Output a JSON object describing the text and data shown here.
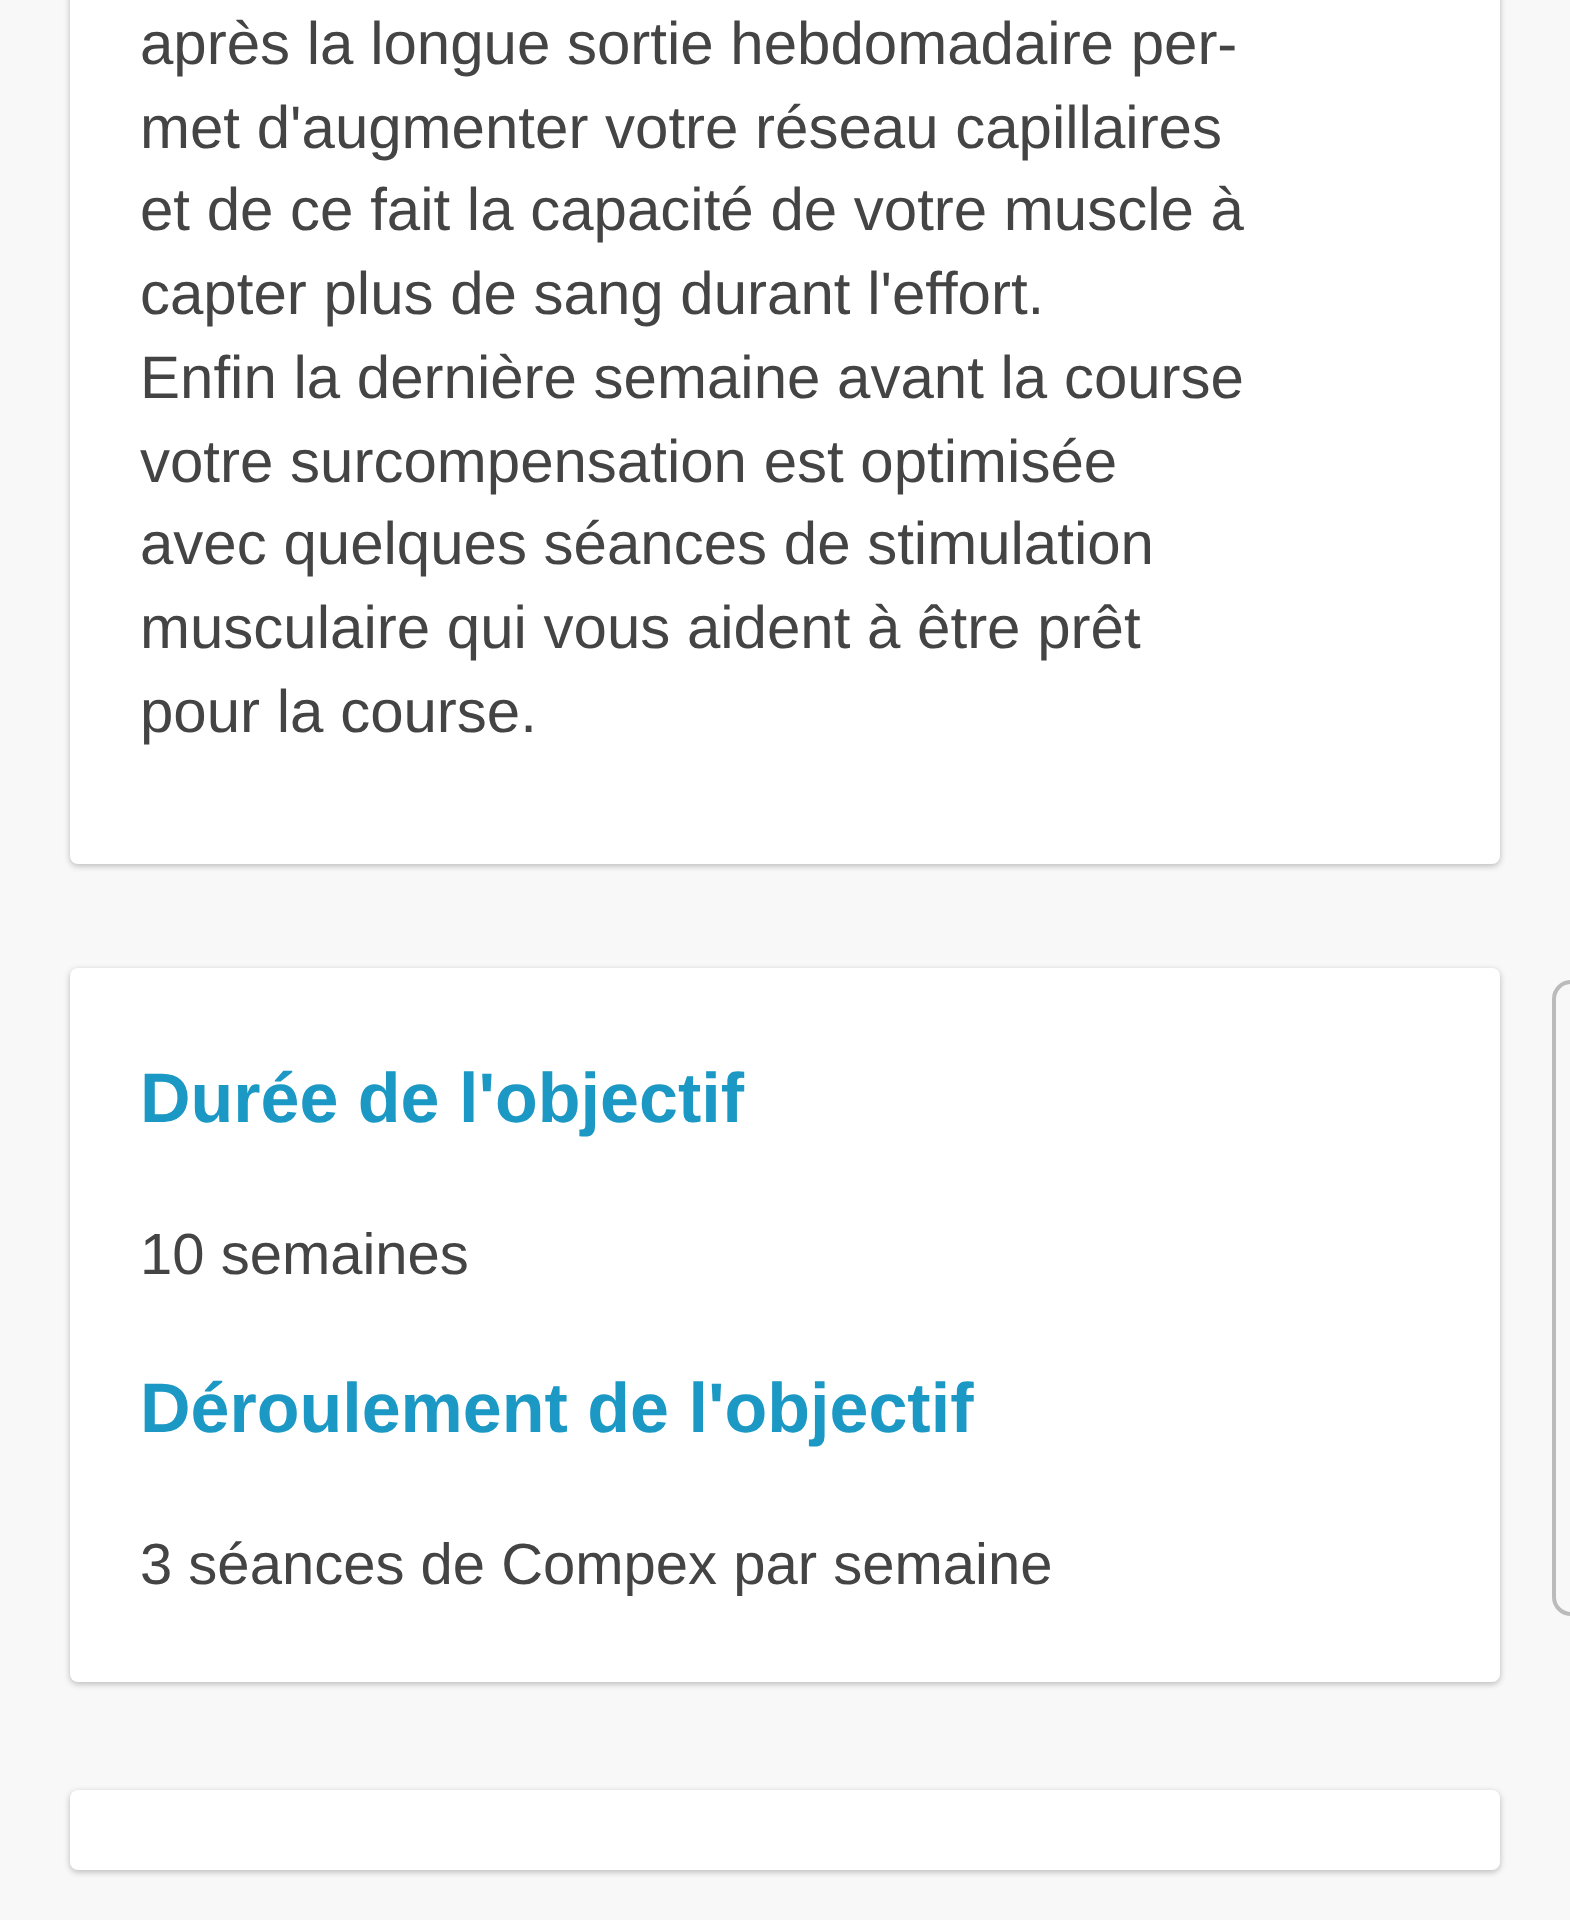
{
  "cards": [
    {
      "paragraph_lines": [
        "après la longue sortie hebdomadaire per-",
        "met d'augmenter votre réseau capillaires",
        "et de ce fait la capacité de votre muscle à",
        "capter plus de sang durant l'effort.",
        "Enfin la dernière semaine avant la course",
        "votre surcompensation est optimisée",
        "avec quelques séances de stimulation",
        "musculaire qui vous aident à être prêt",
        "pour la course."
      ]
    },
    {
      "sections": [
        {
          "heading": "Durée de l'objectif",
          "value": "10 semaines"
        },
        {
          "heading": "Déroulement de l'objectif",
          "value": "3 séances de Compex par semaine"
        }
      ]
    }
  ]
}
